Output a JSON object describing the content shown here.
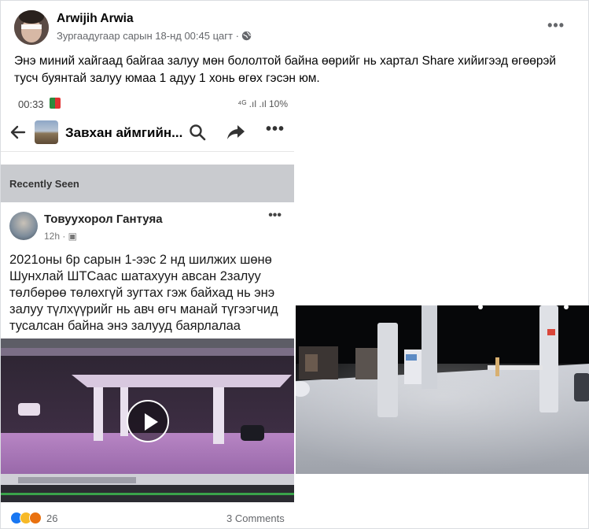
{
  "post": {
    "author": "Arwijih Arwia",
    "timestamp": "Зургаадугаар сарын 18-нд 00:45 цагт ·",
    "privacy_icon": "globe-icon",
    "more_label": "•••",
    "text": "Энэ миний хайгаад байгаа залуу мөн бололтой байна өөрийг нь хартал Share хийигээд өгөөрэй тусч буянтай залуу юмаа 1 адуу 1 хонь өгөх гэсэн юм."
  },
  "phone_screenshot": {
    "status_time": "00:33",
    "status_right": "⁴ᴳ .ıl .ıl 10%",
    "group_name": "Завхан аймгийн...",
    "more_label": "•••",
    "recently_seen": "Recently Seen",
    "inner_post": {
      "author": "Товуухорол Гантуяа",
      "meta": "12h · ▣",
      "more_label": "•••",
      "text": "2021оны 6р сарын 1-ээс 2 нд шилжих шөнө Шунхлай ШТСаас шатахуун авсан 2залуу төлбөрөө төлөхгүй зугтах гэж байхад нь энэ залуу түлхүүрийг нь авч өгч манай түгээгчид тусалсан байна энэ залууд баярлалаа"
    }
  },
  "footer": {
    "reaction_count": "26",
    "comments": "3 Comments"
  },
  "colors": {
    "link_blue": "#1877f2",
    "secondary_text": "#65676b",
    "recent_bar": "#c9cbcf"
  }
}
